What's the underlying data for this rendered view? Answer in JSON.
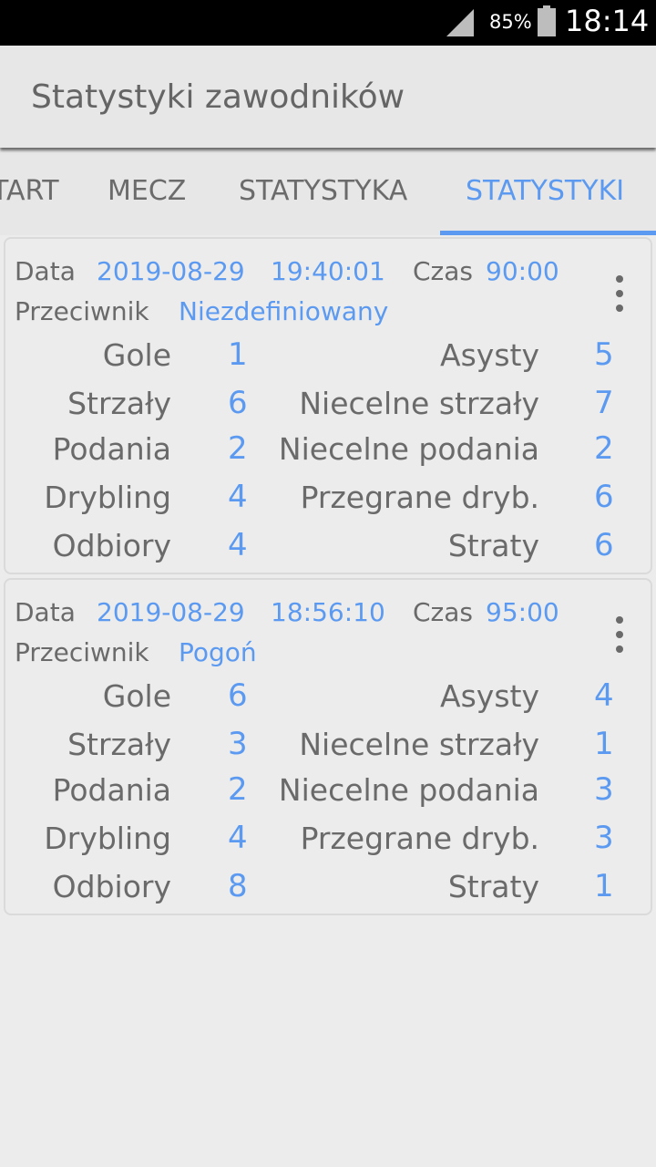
{
  "status_bar": {
    "battery_percent": "85%",
    "time": "18:14"
  },
  "app_bar": {
    "title": "Statystyki zawodników"
  },
  "tabs": [
    {
      "label": "START"
    },
    {
      "label": "MECZ"
    },
    {
      "label": "STATYSTYKA"
    },
    {
      "label": "STATYSTYKI",
      "active": true
    }
  ],
  "labels": {
    "date": "Data",
    "time": "Czas",
    "opponent": "Przeciwnik",
    "goals": "Gole",
    "assists": "Asysty",
    "shots": "Strzały",
    "missed_shots": "Niecelne strzały",
    "passes": "Podania",
    "missed_passes": "Niecelne podania",
    "dribbling": "Drybling",
    "lost_dribbles": "Przegrane dryb.",
    "tackles": "Odbiory",
    "losses": "Straty"
  },
  "matches": [
    {
      "date": "2019-08-29",
      "clock": "19:40:01",
      "duration": "90:00",
      "opponent": "Niezdefiniowany",
      "goals": "1",
      "assists": "5",
      "shots": "6",
      "missed_shots": "7",
      "passes": "2",
      "missed_passes": "2",
      "dribbling": "4",
      "lost_dribbles": "6",
      "tackles": "4",
      "losses": "6"
    },
    {
      "date": "2019-08-29",
      "clock": "18:56:10",
      "duration": "95:00",
      "opponent": "Pogoń",
      "goals": "6",
      "assists": "4",
      "shots": "3",
      "missed_shots": "1",
      "passes": "2",
      "missed_passes": "3",
      "dribbling": "4",
      "lost_dribbles": "3",
      "tackles": "8",
      "losses": "1"
    }
  ]
}
